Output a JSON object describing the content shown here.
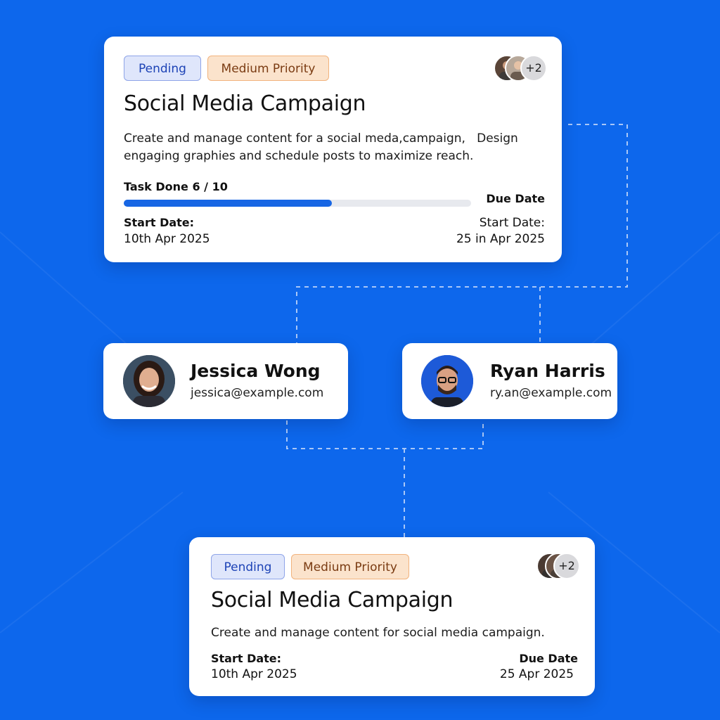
{
  "colors": {
    "background": "#0d67ec",
    "card": "#ffffff",
    "progress_fill": "#1766e4",
    "pending_bg": "#dfe6fb",
    "priority_bg": "#fbe3cc"
  },
  "top_card": {
    "status_badge": "Pending",
    "priority_badge": "Medium Priority",
    "extra_assignees": "+2",
    "title": "Social Media Campaign",
    "description_line1": "Create and manage content for a social meda,campaign,   Design",
    "description_line2": "engaging graphies and schedule posts to maximize reach.",
    "progress_label": "Task Done 6 / 10",
    "progress_fraction": 0.6,
    "due_date_label": "Due Date",
    "start_label_left": "Start Date:",
    "start_value_left": "10th Apr 2025",
    "start_label_right": "Start Date:",
    "start_value_right": "25 in Apr 2025"
  },
  "people": [
    {
      "name": "Jessica Wong",
      "email": "jessica@example.com",
      "avatar_icon": "woman-avatar"
    },
    {
      "name": "Ryan Harris",
      "email": "ry.an@example.com",
      "avatar_icon": "man-avatar"
    }
  ],
  "bottom_card": {
    "status_badge": "Pending",
    "priority_badge": "Medium Priority",
    "extra_assignees": "+2",
    "title": "Social Media Campaign",
    "description": "Create and manage content for social media campaign.",
    "start_label": "Start Date:",
    "start_value": "10th Apr 2025",
    "due_label": "Due Date",
    "due_value": "25 Apr 2025"
  }
}
